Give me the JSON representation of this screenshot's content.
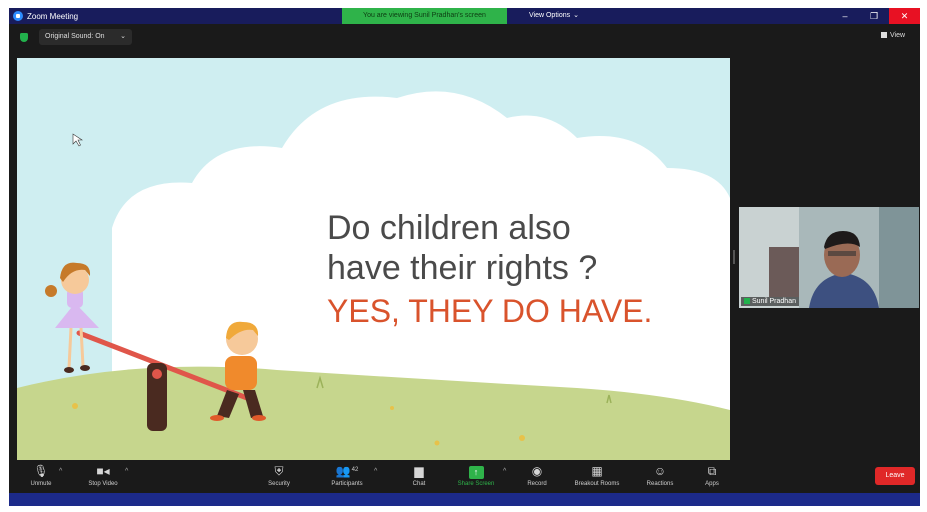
{
  "window": {
    "title": "Zoom Meeting",
    "viewing_banner": "You are viewing Sunil Pradhan's screen",
    "view_options": "View Options",
    "minimize": "–",
    "maximize": "❐",
    "close": "✕"
  },
  "top_row": {
    "name_pill": "Original Sound: On",
    "view_label": "View"
  },
  "slide": {
    "question_line1": "Do children also",
    "question_line2": "have their rights ?",
    "answer": "YES, THEY DO HAVE."
  },
  "participant": {
    "name": "Sunil Pradhan"
  },
  "toolbar": {
    "items": [
      {
        "label": "Unmute",
        "icon": "mic-muted-icon"
      },
      {
        "label": "Stop Video",
        "icon": "video-camera-icon"
      },
      {
        "label": "Security",
        "icon": "shield-icon"
      },
      {
        "label": "Participants",
        "icon": "participants-icon",
        "count": "42"
      },
      {
        "label": "Chat",
        "icon": "chat-icon"
      },
      {
        "label": "Share Screen",
        "icon": "share-screen-icon"
      },
      {
        "label": "Record",
        "icon": "record-icon"
      },
      {
        "label": "Breakout Rooms",
        "icon": "breakout-rooms-icon"
      },
      {
        "label": "Reactions",
        "icon": "reactions-icon"
      },
      {
        "label": "Apps",
        "icon": "apps-icon"
      }
    ],
    "end": "Leave"
  },
  "colors": {
    "title_bar": "#181c5c",
    "banner_green": "#2fb34a",
    "end_red": "#e02828",
    "answer_text": "#d9532c",
    "question_text": "#4a4a4a",
    "sky": "#cfeef1",
    "grass": "#c6d68d"
  }
}
